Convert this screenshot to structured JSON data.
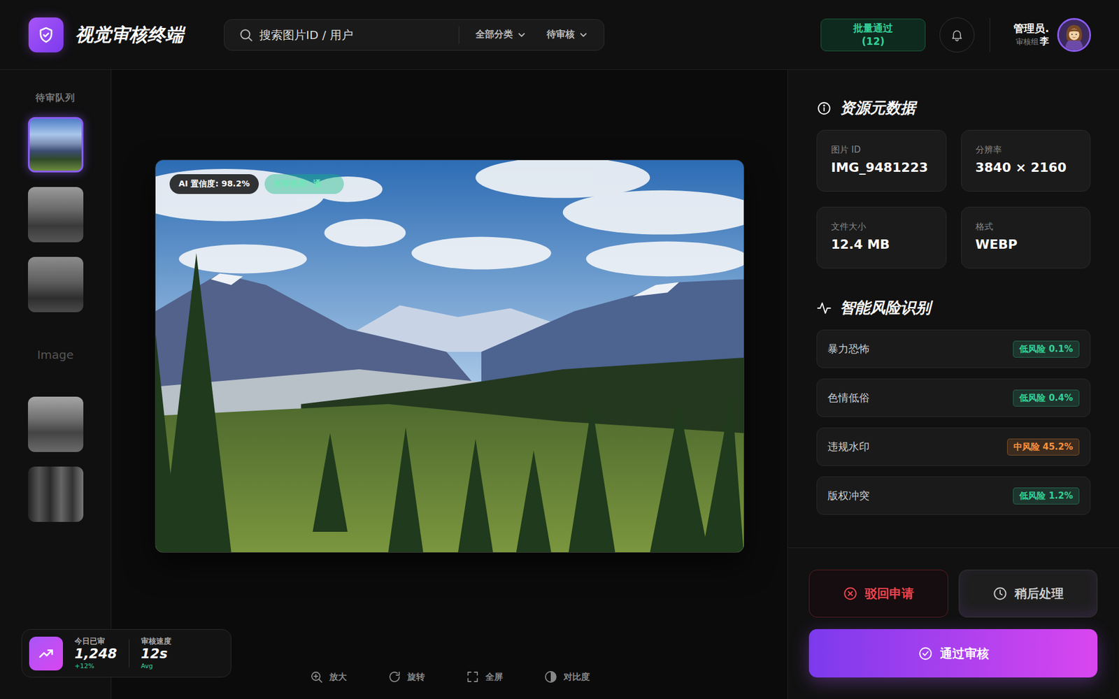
{
  "app": {
    "title": "视觉审核终端"
  },
  "search": {
    "placeholder": "搜索图片ID / 用户"
  },
  "filters": [
    {
      "label": "全部分类"
    },
    {
      "label": "待审核"
    }
  ],
  "batch_button": {
    "label": "批量通过",
    "count": "(12)"
  },
  "user": {
    "name": "管理员.",
    "role": "审核组",
    "suffix": "李"
  },
  "queue": {
    "title": "待审队列",
    "items": [
      {
        "kind": "thumb",
        "selected": true
      },
      {
        "kind": "thumb",
        "selected": false
      },
      {
        "kind": "thumb",
        "selected": false
      },
      {
        "kind": "placeholder",
        "label": "Image",
        "selected": false
      },
      {
        "kind": "thumb",
        "selected": false
      },
      {
        "kind": "thumb",
        "selected": false
      }
    ]
  },
  "stats": [
    {
      "label": "今日已审",
      "value": "1,248",
      "note": "+12%"
    },
    {
      "label": "审核速度",
      "value": "12s",
      "note": "Avg"
    }
  ],
  "preview": {
    "badges": [
      {
        "label": "AI 置信度: 98.2%",
        "kind": "dark"
      },
      {
        "label": "初审推荐: 通",
        "kind": "green"
      }
    ]
  },
  "tools": [
    {
      "label": "放大",
      "kind": "zoom"
    },
    {
      "label": "旋转",
      "kind": "rotate"
    },
    {
      "label": "全屏",
      "kind": "fullscreen"
    },
    {
      "label": "对比度",
      "kind": "contrast"
    }
  ],
  "metadata": {
    "title": "资源元数据",
    "fields": [
      {
        "label": "图片 ID",
        "value": "IMG_9481223"
      },
      {
        "label": "分辨率",
        "value": "3840 × 2160"
      },
      {
        "label": "文件大小",
        "value": "12.4 MB"
      },
      {
        "label": "格式",
        "value": "WEBP"
      }
    ]
  },
  "risks": {
    "title": "智能风险识别",
    "items": [
      {
        "name": "暴力恐怖",
        "level": "低风险",
        "value": "0.1%",
        "color": "#34d399"
      },
      {
        "name": "色情低俗",
        "level": "低风险",
        "value": "0.4%",
        "color": "#34d399"
      },
      {
        "name": "违规水印",
        "level": "中风险",
        "value": "45.2%",
        "color": "#fb923c"
      },
      {
        "name": "版权冲突",
        "level": "低风险",
        "value": "1.2%",
        "color": "#34d399"
      }
    ]
  },
  "actions": [
    {
      "label": "驳回申请",
      "kind": "reject"
    },
    {
      "label": "稍后处理",
      "kind": "later"
    },
    {
      "label": "通过审核",
      "kind": "approve"
    }
  ]
}
